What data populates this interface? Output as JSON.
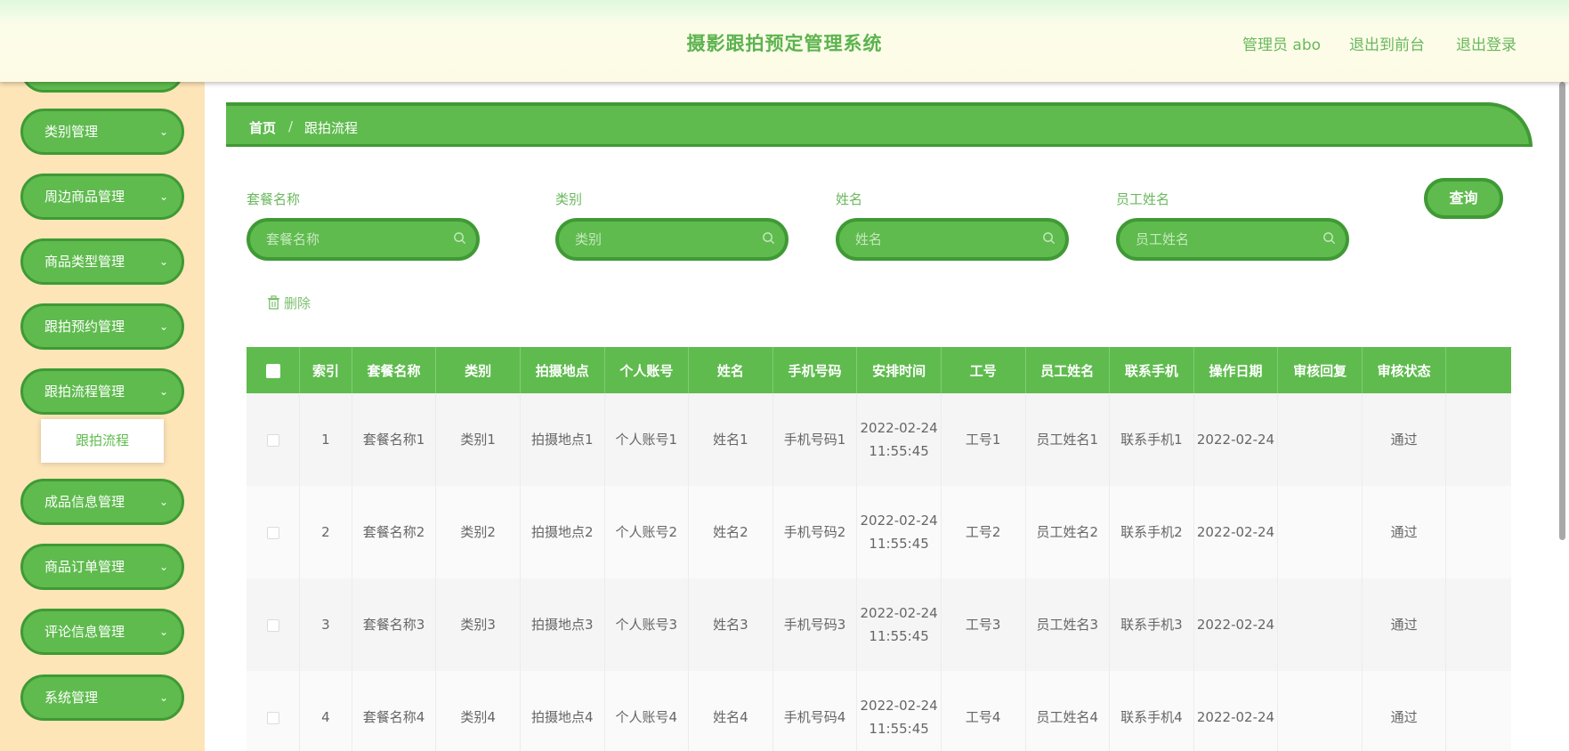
{
  "header": {
    "title": "摄影跟拍预定管理系统",
    "user_label": "管理员 abo",
    "front_link": "退出到前台",
    "logout_link": "退出登录"
  },
  "sidebar": {
    "items": [
      {
        "label": "类别管理"
      },
      {
        "label": "周边商品管理"
      },
      {
        "label": "商品类型管理"
      },
      {
        "label": "跟拍预约管理"
      },
      {
        "label": "跟拍流程管理"
      },
      {
        "label": "成品信息管理"
      },
      {
        "label": "商品订单管理"
      },
      {
        "label": "评论信息管理"
      },
      {
        "label": "系统管理"
      }
    ],
    "active_sub": "跟拍流程"
  },
  "breadcrumb": {
    "home": "首页",
    "separator": "/",
    "current": "跟拍流程"
  },
  "search": {
    "fields": [
      {
        "label": "套餐名称",
        "placeholder": "套餐名称"
      },
      {
        "label": "类别",
        "placeholder": "类别"
      },
      {
        "label": "姓名",
        "placeholder": "姓名"
      },
      {
        "label": "员工姓名",
        "placeholder": "员工姓名"
      }
    ],
    "query_label": "查询",
    "delete_label": "删除"
  },
  "table": {
    "headers": [
      "索引",
      "套餐名称",
      "类别",
      "拍摄地点",
      "个人账号",
      "姓名",
      "手机号码",
      "安排时间",
      "工号",
      "员工姓名",
      "联系手机",
      "操作日期",
      "审核回复",
      "审核状态"
    ],
    "rows": [
      {
        "index": "1",
        "package": "套餐名称1",
        "category": "类别1",
        "location": "拍摄地点1",
        "account": "个人账号1",
        "name": "姓名1",
        "phone": "手机号码1",
        "schedule": "2022-02-24 11:55:45",
        "staff_no": "工号1",
        "staff_name": "员工姓名1",
        "contact": "联系手机1",
        "op_date": "2022-02-24",
        "reply": "",
        "status": "通过"
      },
      {
        "index": "2",
        "package": "套餐名称2",
        "category": "类别2",
        "location": "拍摄地点2",
        "account": "个人账号2",
        "name": "姓名2",
        "phone": "手机号码2",
        "schedule": "2022-02-24 11:55:45",
        "staff_no": "工号2",
        "staff_name": "员工姓名2",
        "contact": "联系手机2",
        "op_date": "2022-02-24",
        "reply": "",
        "status": "通过"
      },
      {
        "index": "3",
        "package": "套餐名称3",
        "category": "类别3",
        "location": "拍摄地点3",
        "account": "个人账号3",
        "name": "姓名3",
        "phone": "手机号码3",
        "schedule": "2022-02-24 11:55:45",
        "staff_no": "工号3",
        "staff_name": "员工姓名3",
        "contact": "联系手机3",
        "op_date": "2022-02-24",
        "reply": "",
        "status": "通过"
      },
      {
        "index": "4",
        "package": "套餐名称4",
        "category": "类别4",
        "location": "拍摄地点4",
        "account": "个人账号4",
        "name": "姓名4",
        "phone": "手机号码4",
        "schedule": "2022-02-24 11:55:45",
        "staff_no": "工号4",
        "staff_name": "员工姓名4",
        "contact": "联系手机4",
        "op_date": "2022-02-24",
        "reply": "",
        "status": "通过"
      }
    ]
  },
  "colors": {
    "primary": "#5fbb4e",
    "primary_dark": "#3f9a35",
    "sidebar_bg": "#fde5b8",
    "title_green": "#5cb34f"
  },
  "icons": {
    "search": "search-icon",
    "delete": "trash-icon",
    "menu_toggle": "chevron-down-icon",
    "edit": "document-icon"
  }
}
